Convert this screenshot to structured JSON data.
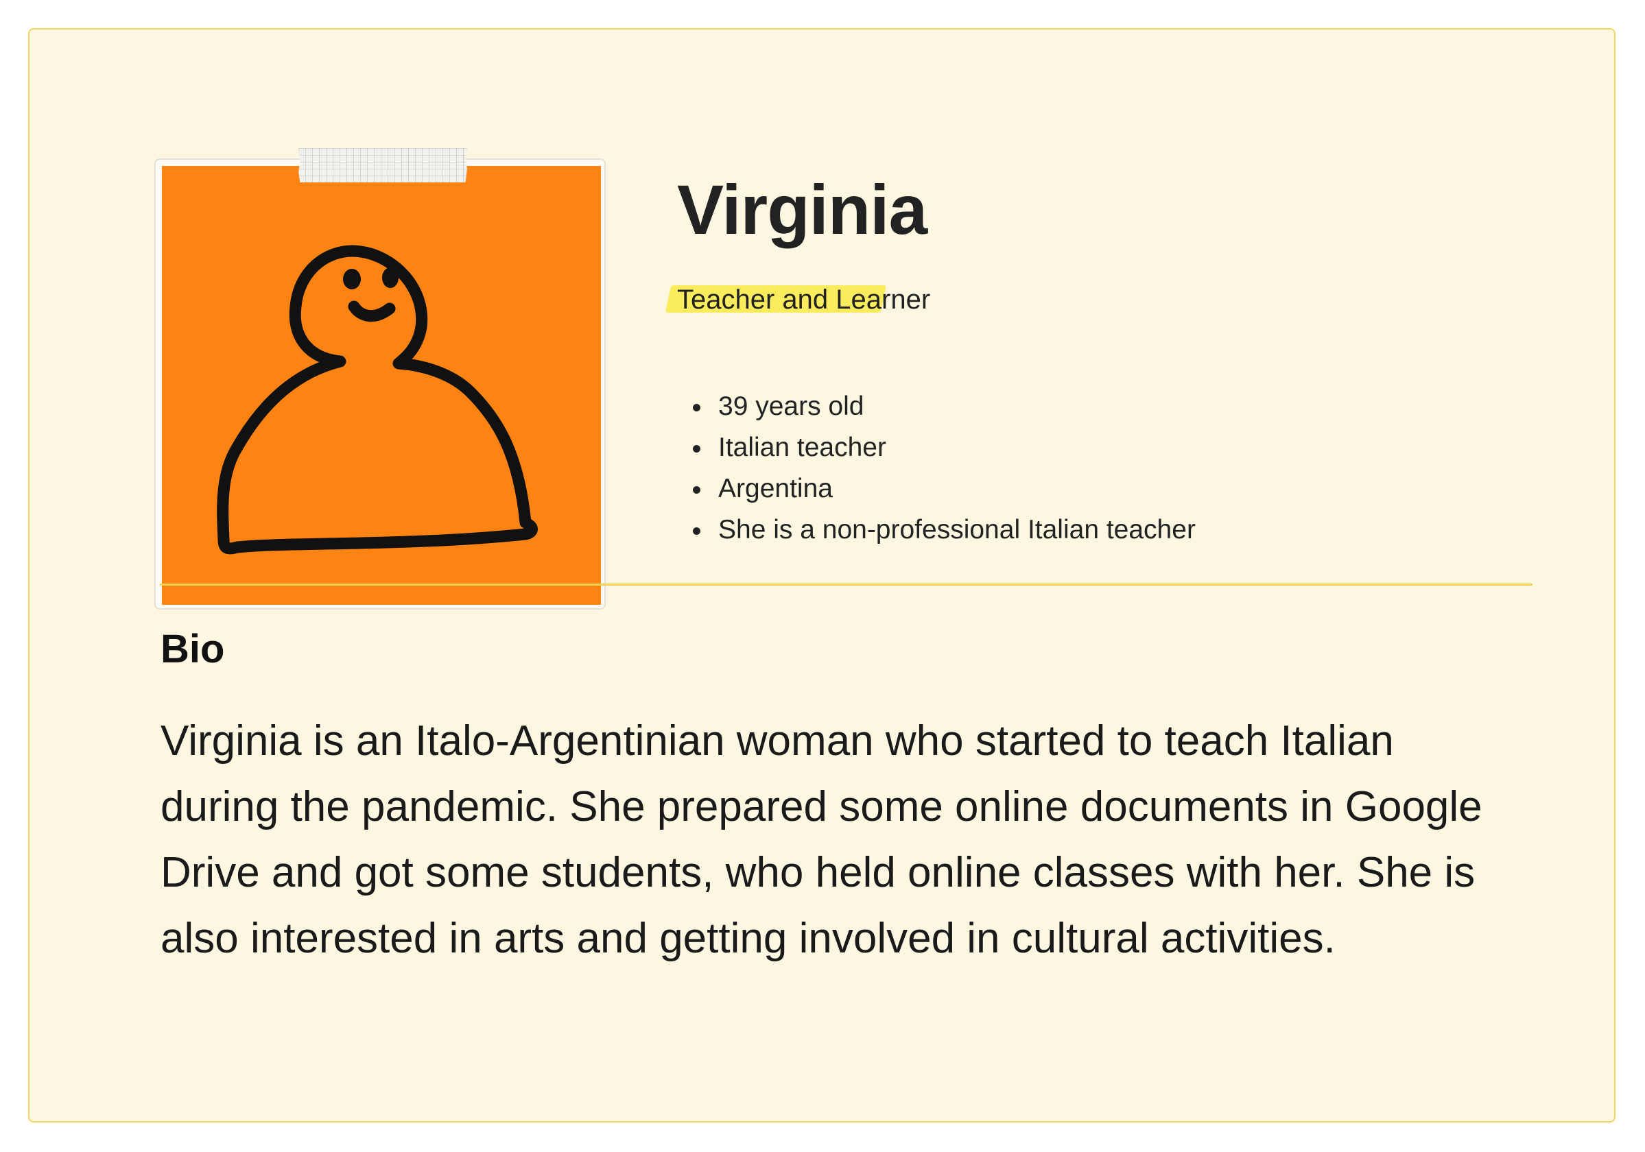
{
  "persona": {
    "name": "Virginia",
    "role": "Teacher and Learner",
    "facts": [
      "39 years old",
      "Italian teacher",
      "Argentina",
      "She is a non-professional Italian teacher"
    ],
    "avatar_icon": "person-doodle-icon",
    "avatar_background": "#fd8313",
    "highlight_color": "#fbec5d"
  },
  "bio": {
    "heading": "Bio",
    "text": "Virginia is an Italo-Argentinian woman who started to teach Italian during the pandemic. She prepared some online documents in Google Drive and got some students, who held online classes with her. She is also interested in arts and getting involved in cultural activities."
  },
  "theme": {
    "card_background": "#fdf6e1",
    "card_border": "#f2d660",
    "divider": "#f2d24e"
  }
}
